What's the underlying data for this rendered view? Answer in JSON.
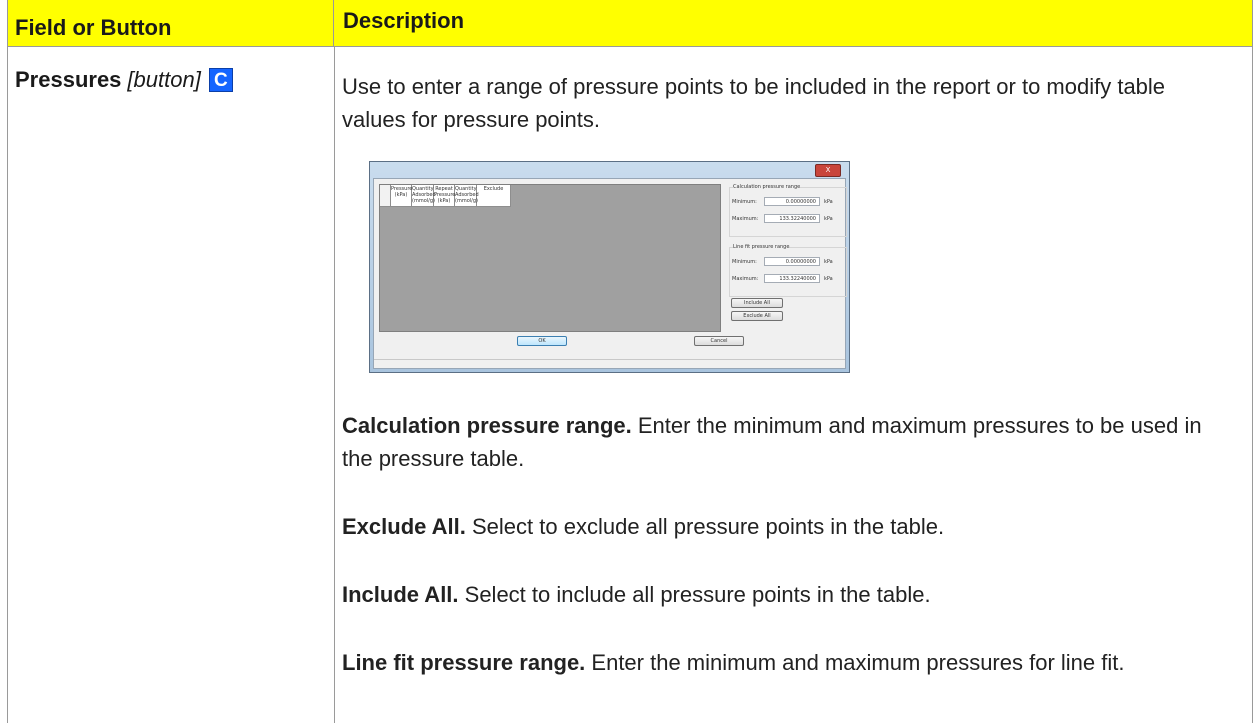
{
  "header": {
    "col1": "Field or Button",
    "col2": "Description"
  },
  "row": {
    "field_name": "Pressures",
    "field_type": "[button]",
    "icon_letter": "C",
    "intro": "Use to enter a range of pressure points to be included in the report or to modify table values for pressure points.",
    "items": [
      {
        "term": "Calculation pressure range.",
        "text": " Enter the minimum and maximum pressures to be used in the pressure table."
      },
      {
        "term": "Exclude All.",
        "text": "  Select to exclude all pressure points in the table."
      },
      {
        "term": "Include All.",
        "text": "  Select to include all pressure points in the table."
      },
      {
        "term": "Line fit pressure range.",
        "text": "  Enter the minimum and maximum pressures for line fit."
      }
    ]
  },
  "dialog": {
    "close_label": "X",
    "columns": [
      "Pressure (kPa)",
      "Quantity Adsorbed (mmol/g)",
      "Repeat Pressure (kPa)",
      "Quantity Adsorbed (mmol/g)",
      "Exclude"
    ],
    "calc_group": {
      "title": "Calculation pressure range",
      "min_label": "Minimum:",
      "min_value": "0.00000000",
      "max_label": "Maximum:",
      "max_value": "133.32240000",
      "unit": "kPa"
    },
    "line_group": {
      "title": "Line fit pressure range",
      "min_label": "Minimum:",
      "min_value": "0.00000000",
      "max_label": "Maximum:",
      "max_value": "133.32240000",
      "unit": "kPa"
    },
    "include_all": "Include All",
    "exclude_all": "Exclude All",
    "ok": "OK",
    "cancel": "Cancel"
  },
  "colors": {
    "header_bg": "#ffff00",
    "icon_bg": "#1565ff"
  }
}
